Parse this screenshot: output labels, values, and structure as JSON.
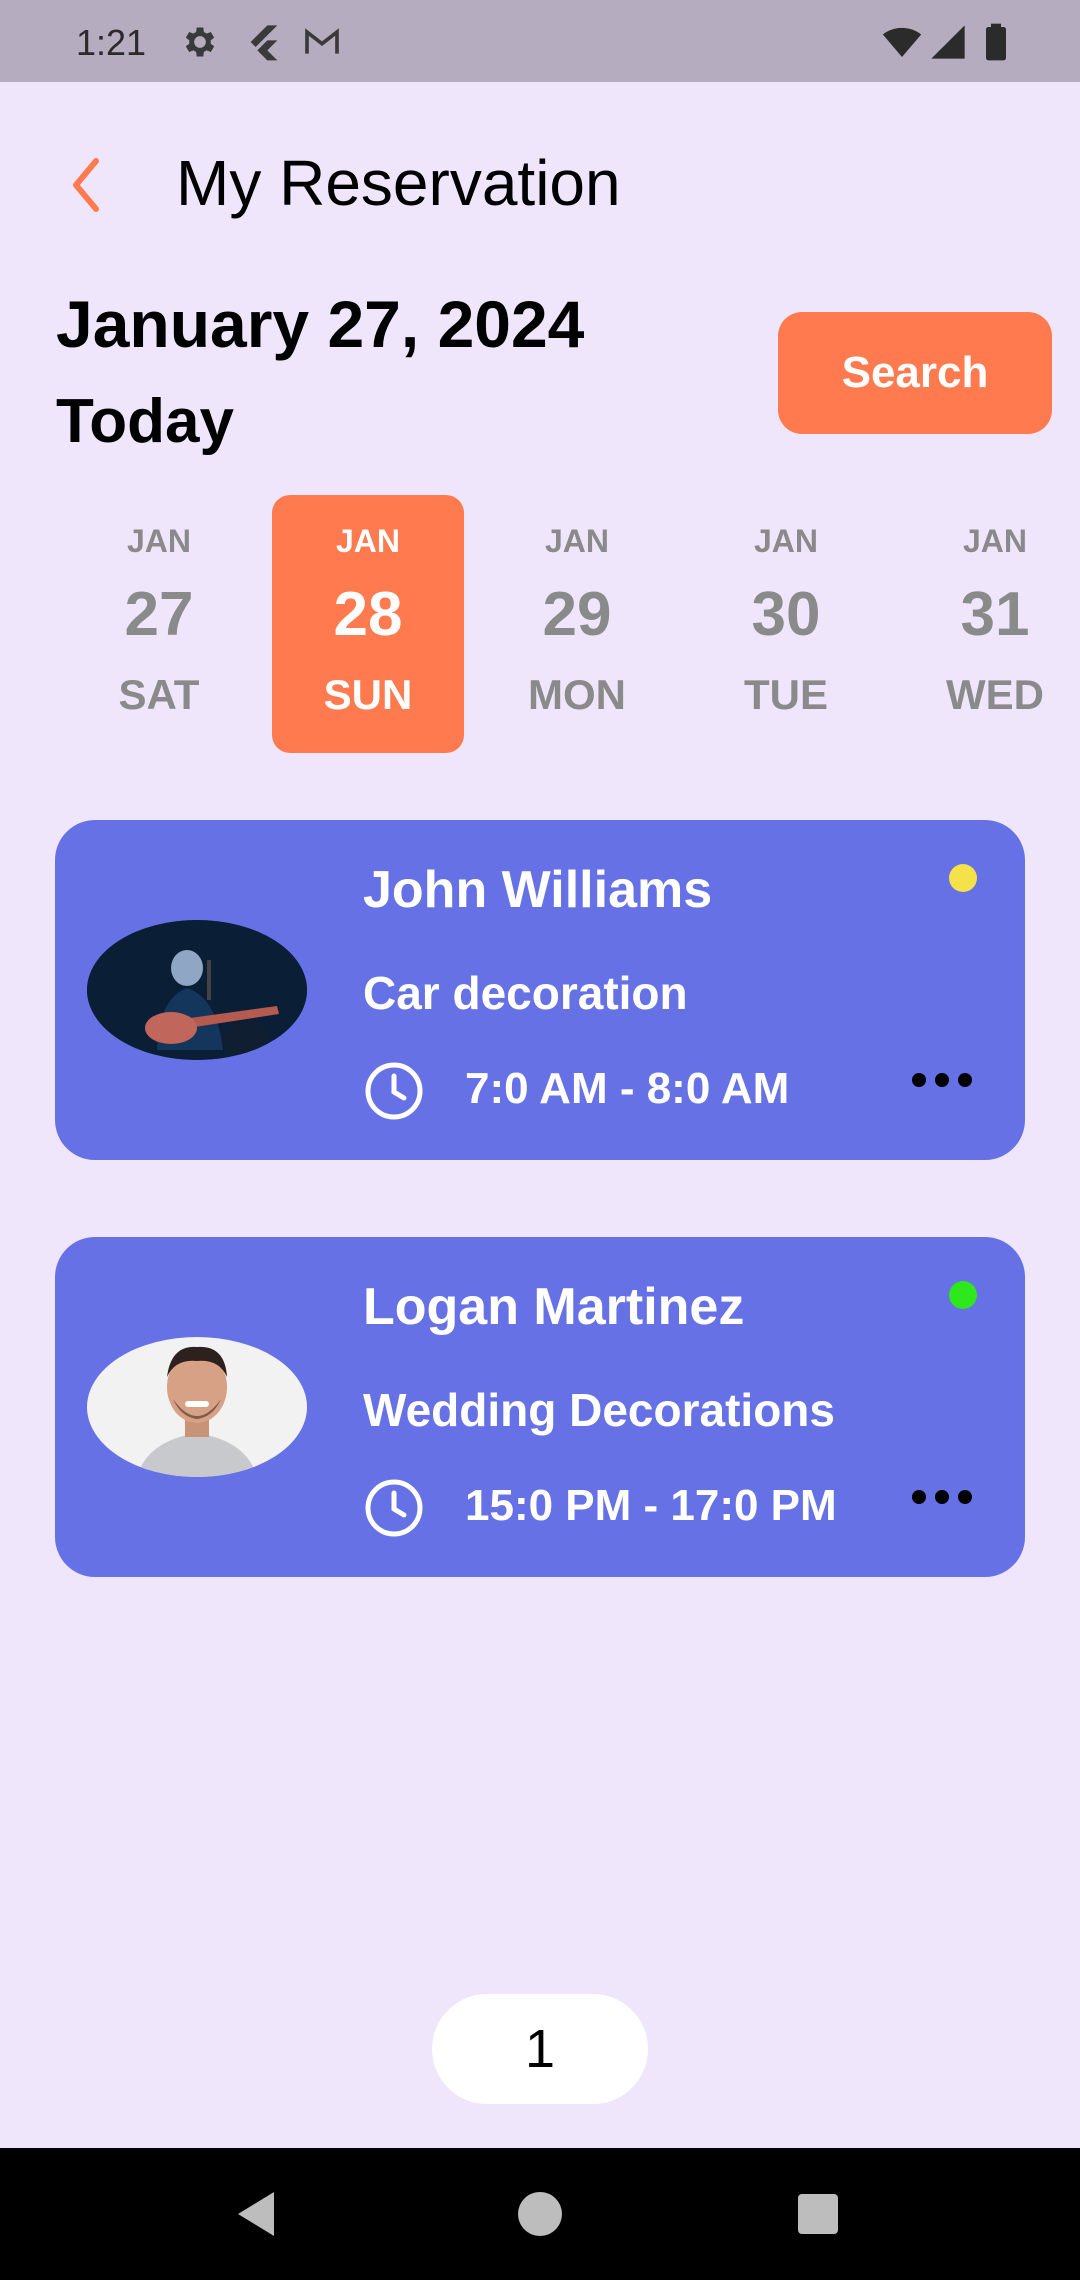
{
  "status_bar": {
    "time": "1:21",
    "left_icons": [
      "gear-icon",
      "flutter-icon",
      "gmail-icon"
    ],
    "right_icons": [
      "wifi-icon",
      "signal-icon",
      "battery-icon"
    ]
  },
  "header": {
    "back_icon": "chevron-left-icon",
    "title": "My Reservation"
  },
  "date_header": {
    "date": "January 27, 2024",
    "relative": "Today",
    "search_label": "Search"
  },
  "date_strip": [
    {
      "month": "JAN",
      "day": "27",
      "weekday": "SAT",
      "selected": false
    },
    {
      "month": "JAN",
      "day": "28",
      "weekday": "SUN",
      "selected": true
    },
    {
      "month": "JAN",
      "day": "29",
      "weekday": "MON",
      "selected": false
    },
    {
      "month": "JAN",
      "day": "30",
      "weekday": "TUE",
      "selected": false
    },
    {
      "month": "JAN",
      "day": "31",
      "weekday": "WED",
      "selected": false
    }
  ],
  "reservations": [
    {
      "name": "John Williams",
      "service": "Car decoration",
      "time": "7:0 AM - 8:0 AM",
      "status_color": "#F5E14A"
    },
    {
      "name": "Logan Martinez",
      "service": "Wedding Decorations",
      "time": "15:0 PM - 17:0 PM",
      "status_color": "#2EE81C"
    }
  ],
  "pagination": {
    "page": "1"
  },
  "nav_bar": {
    "icons": [
      "back-triangle-icon",
      "home-circle-icon",
      "recents-square-icon"
    ]
  },
  "colors": {
    "background": "#F0E6FC",
    "accent": "#FF7A4F",
    "card": "#6771E6",
    "status_bar": "#B5ADBF"
  }
}
